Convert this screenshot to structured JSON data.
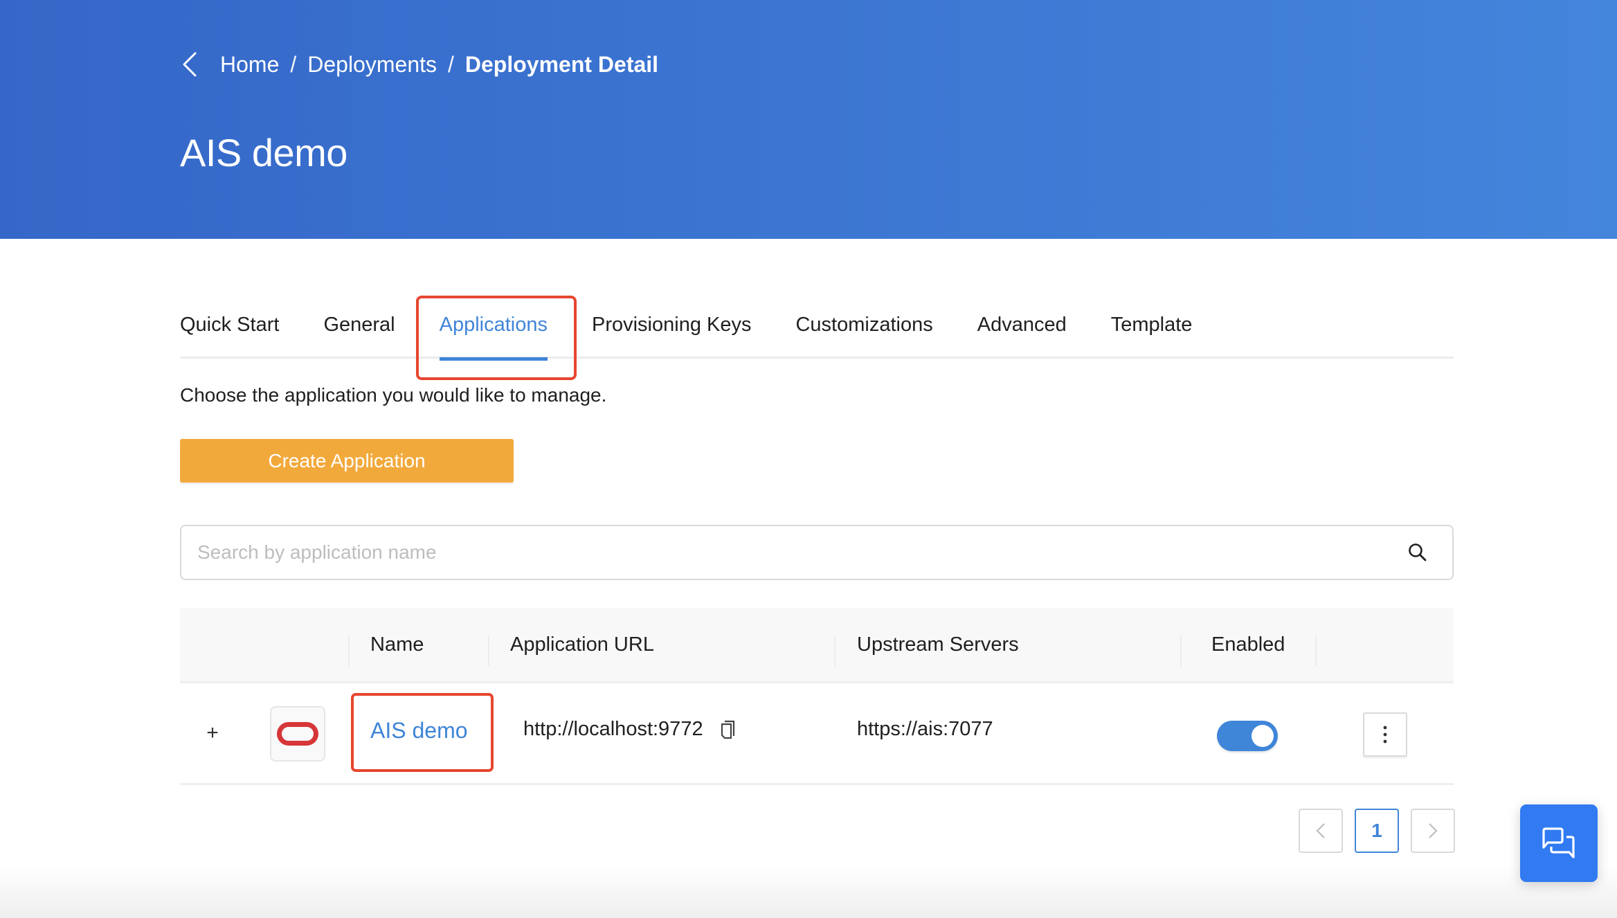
{
  "header": {
    "breadcrumb": [
      {
        "label": "Home"
      },
      {
        "label": "Deployments"
      },
      {
        "label": "Deployment Detail"
      }
    ],
    "separator": "/",
    "title": "AIS demo",
    "gradient_start": "#3567c8",
    "gradient_end": "#4485dc"
  },
  "tabs": [
    {
      "label": "Quick Start",
      "active": false
    },
    {
      "label": "General",
      "active": false
    },
    {
      "label": "Applications",
      "active": true
    },
    {
      "label": "Provisioning Keys",
      "active": false
    },
    {
      "label": "Customizations",
      "active": false
    },
    {
      "label": "Advanced",
      "active": false
    },
    {
      "label": "Template",
      "active": false
    }
  ],
  "main": {
    "description": "Choose the application you would like to manage.",
    "create_button_label": "Create Application",
    "search": {
      "placeholder": "Search by application name",
      "value": ""
    }
  },
  "table": {
    "columns": [
      "",
      "",
      "Name",
      "Application URL",
      "Upstream Servers",
      "Enabled",
      ""
    ],
    "rows": [
      {
        "expand_symbol": "+",
        "logo": "oracle-logo",
        "name": "AIS demo",
        "application_url": "http://localhost:9772",
        "upstream_servers": "https://ais:7077",
        "enabled": true
      }
    ]
  },
  "pagination": {
    "prev": "<",
    "current_page": "1",
    "next": ">"
  },
  "icons": {
    "back": "chevron-left-icon",
    "search": "search-icon",
    "copy": "copy-icon",
    "more": "more-vertical-icon",
    "chat": "chat-icon"
  },
  "colors": {
    "accent": "#3f85d8",
    "primary_button": "#f2a93b",
    "highlight": "#e74630",
    "chat_button": "#317af2",
    "oracle_red": "#d63638"
  }
}
